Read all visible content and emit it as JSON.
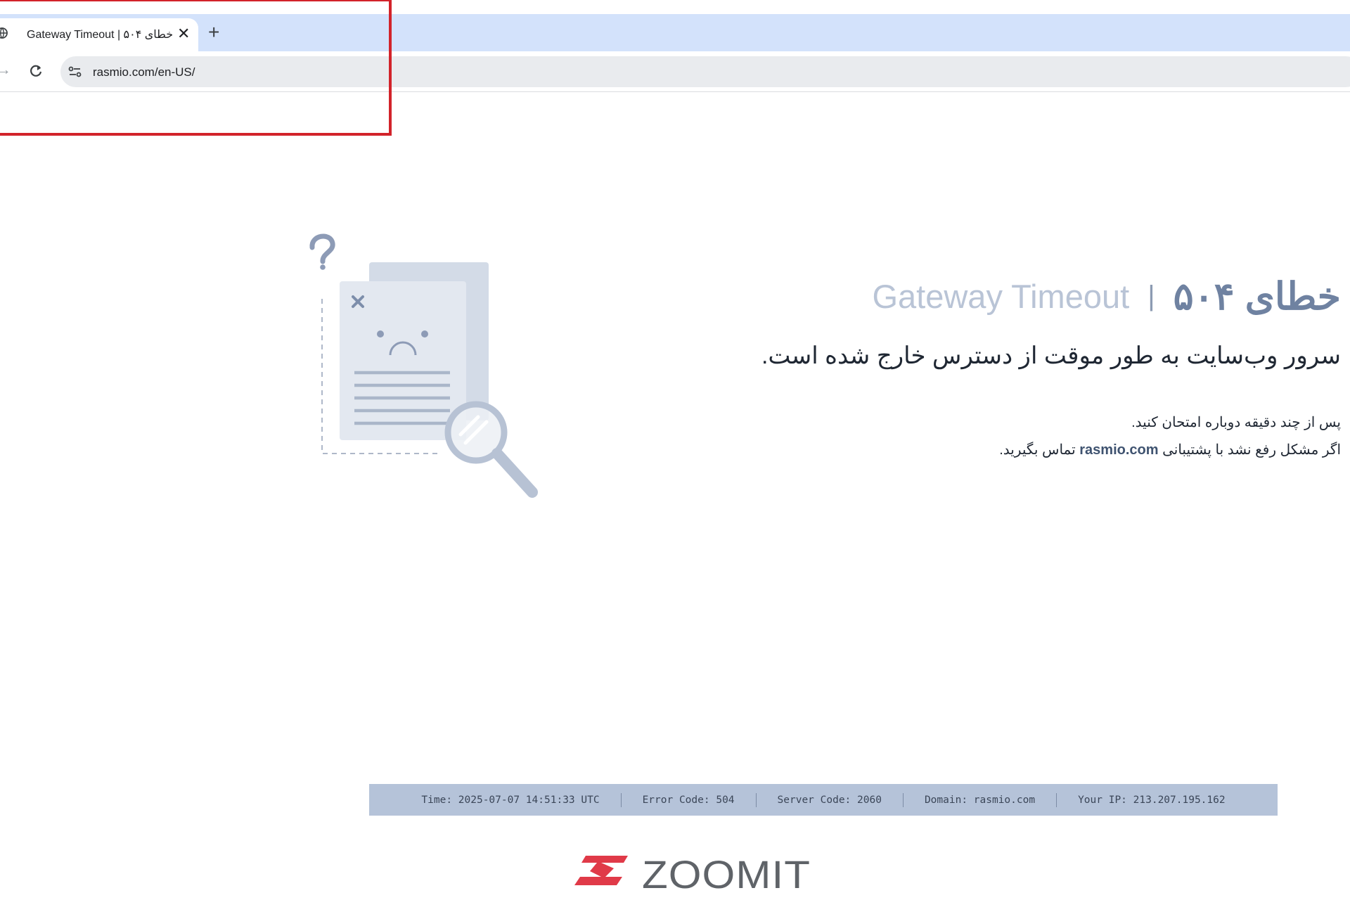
{
  "browser": {
    "tab_title": "Gateway Timeout | خطای ۵۰۴",
    "tab_close": "✕",
    "new_tab": "+",
    "forward": "→",
    "url": "rasmio.com/en-US/"
  },
  "error": {
    "title_fa": "خطای ۵۰۴",
    "separator": "|",
    "title_en": "Gateway Timeout",
    "subtitle": "سرور وب‌سایت به طور موقت از دسترس خارج شده است.",
    "message_1": "پس از چند دقیقه دوباره امتحان کنید.",
    "message_2_before": "اگر مشکل رفع نشد با پشتیبانی",
    "message_2_domain": "rasmio.com",
    "message_2_after": "تماس بگیرید."
  },
  "info_bar": {
    "time": "Time: 2025-07-07 14:51:33 UTC",
    "error_code": "Error Code: 504",
    "server_code": "Server Code: 2060",
    "domain": "Domain: rasmio.com",
    "ip": "Your IP: 213.207.195.162"
  },
  "watermark": {
    "brand": "ZOOMIT"
  },
  "colors": {
    "highlight": "#d2232a",
    "tabstrip": "#d3e2fb",
    "title_fa": "#6f82a1",
    "title_en": "#b9c4d6",
    "info_bar": "#b5c3d9",
    "logo_red": "#e03a48",
    "logo_gray": "#5f6368"
  },
  "icons": [
    "globe-icon",
    "close-icon",
    "plus-icon",
    "forward-arrow-icon",
    "reload-icon",
    "site-settings-icon",
    "error-document-icon",
    "magnifier-icon",
    "question-mark-icon"
  ]
}
